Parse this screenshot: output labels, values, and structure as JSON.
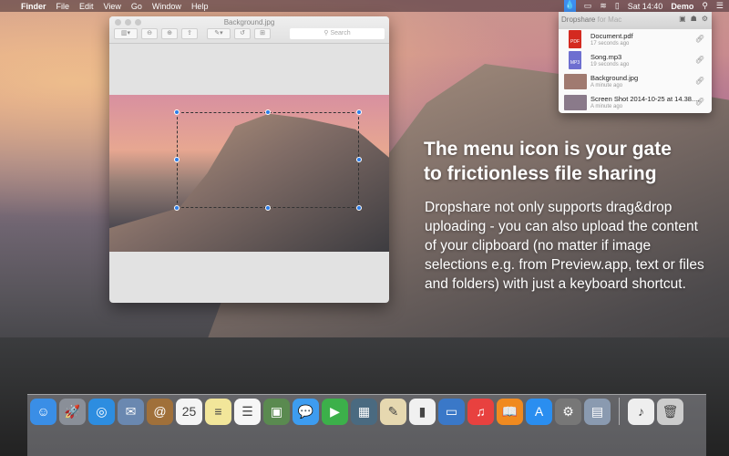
{
  "menubar": {
    "apple": "",
    "app": "Finder",
    "items": [
      "File",
      "Edit",
      "View",
      "Go",
      "Window",
      "Help"
    ],
    "clock": "Sat 14:40",
    "user": "Demo"
  },
  "preview": {
    "title": "Background.jpg",
    "search_placeholder": "Search"
  },
  "dropshare": {
    "title": "Dropshare",
    "subtitle": "for Mac",
    "files": [
      {
        "name": "Document.pdf",
        "time": "17 seconds ago",
        "type": "PDF",
        "color": "#d42a20"
      },
      {
        "name": "Song.mp3",
        "time": "19 seconds ago",
        "type": "MP3",
        "color": "#6e6fd0"
      },
      {
        "name": "Background.jpg",
        "time": "A minute ago",
        "type": "",
        "color": "#a07a70"
      },
      {
        "name": "Screen Shot 2014-10-25 at 14.38....",
        "time": "A minute ago",
        "type": "",
        "color": "#8a7a8a"
      }
    ]
  },
  "headline": [
    "The menu icon is your gate",
    "to frictionless file sharing"
  ],
  "body": "Dropshare not only supports drag&drop uploading - you can also upload the content of your clipboard (no matter if image selections e.g. from Preview.app, text or files and folders) with just a keyboard shortcut.",
  "dock": {
    "apps": [
      {
        "name": "finder",
        "color": "#3a8ee6",
        "glyph": "☺"
      },
      {
        "name": "launchpad",
        "color": "#8a8f98",
        "glyph": "🚀"
      },
      {
        "name": "safari",
        "color": "#2d8de0",
        "glyph": "◎"
      },
      {
        "name": "mail",
        "color": "#6a88b0",
        "glyph": "✉"
      },
      {
        "name": "contacts",
        "color": "#a0703a",
        "glyph": "@"
      },
      {
        "name": "calendar",
        "color": "#f4f4f4",
        "glyph": "25"
      },
      {
        "name": "notes",
        "color": "#f2e69a",
        "glyph": "≡"
      },
      {
        "name": "reminders",
        "color": "#f6f6f6",
        "glyph": "☰"
      },
      {
        "name": "photo-booth",
        "color": "#5a8a50",
        "glyph": "▣"
      },
      {
        "name": "messages",
        "color": "#3d9cf0",
        "glyph": "💬"
      },
      {
        "name": "facetime",
        "color": "#3cb04a",
        "glyph": "▶"
      },
      {
        "name": "image-capture",
        "color": "#4a6a80",
        "glyph": "▦"
      },
      {
        "name": "textedit",
        "color": "#e6d8b0",
        "glyph": "✎"
      },
      {
        "name": "numbers",
        "color": "#f0f0f0",
        "glyph": "▮"
      },
      {
        "name": "keynote",
        "color": "#3a78c8",
        "glyph": "▭"
      },
      {
        "name": "itunes",
        "color": "#e8413f",
        "glyph": "♫"
      },
      {
        "name": "ibooks",
        "color": "#f08a20",
        "glyph": "📖"
      },
      {
        "name": "app-store",
        "color": "#2a8ef0",
        "glyph": "A"
      },
      {
        "name": "system-preferences",
        "color": "#777",
        "glyph": "⚙"
      },
      {
        "name": "preview",
        "color": "#8a9ab0",
        "glyph": "▤"
      }
    ],
    "stacks": [
      {
        "name": "documents",
        "color": "#eee",
        "glyph": "♪"
      },
      {
        "name": "trash",
        "color": "#ccc",
        "glyph": "🗑"
      }
    ]
  }
}
